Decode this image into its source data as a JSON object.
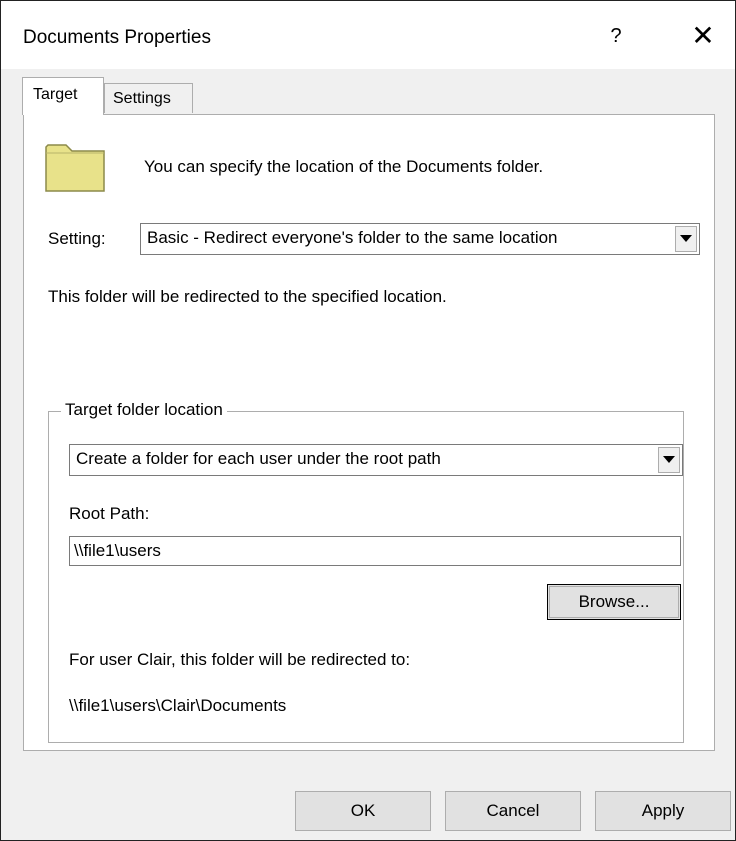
{
  "window": {
    "title": "Documents Properties",
    "help": "?",
    "close": "✕"
  },
  "tabs": [
    {
      "label": "Target",
      "active": true
    },
    {
      "label": "Settings",
      "active": false
    }
  ],
  "target_tab": {
    "info": "You can specify the location of the Documents folder.",
    "setting_label": "Setting:",
    "setting_value": "Basic - Redirect everyone's folder to the same location",
    "redirect_text": "This folder will be redirected to the specified location.",
    "group": {
      "legend": "Target folder location",
      "target_value": "Create a folder for each user under the root path",
      "root_path_label": "Root Path:",
      "root_path_value": "\\\\file1\\users",
      "browse_label": "Browse...",
      "user_text": "For user Clair, this folder will be redirected to:",
      "resolved_path": "\\\\file1\\users\\Clair\\Documents"
    }
  },
  "buttons": {
    "ok": "OK",
    "cancel": "Cancel",
    "apply": "Apply"
  },
  "colors": {
    "folder_fill": "#e8e28a",
    "folder_border": "#8c8a4a"
  },
  "icons": {
    "folder": "folder-icon",
    "dropdown": "chevron-down-icon"
  }
}
